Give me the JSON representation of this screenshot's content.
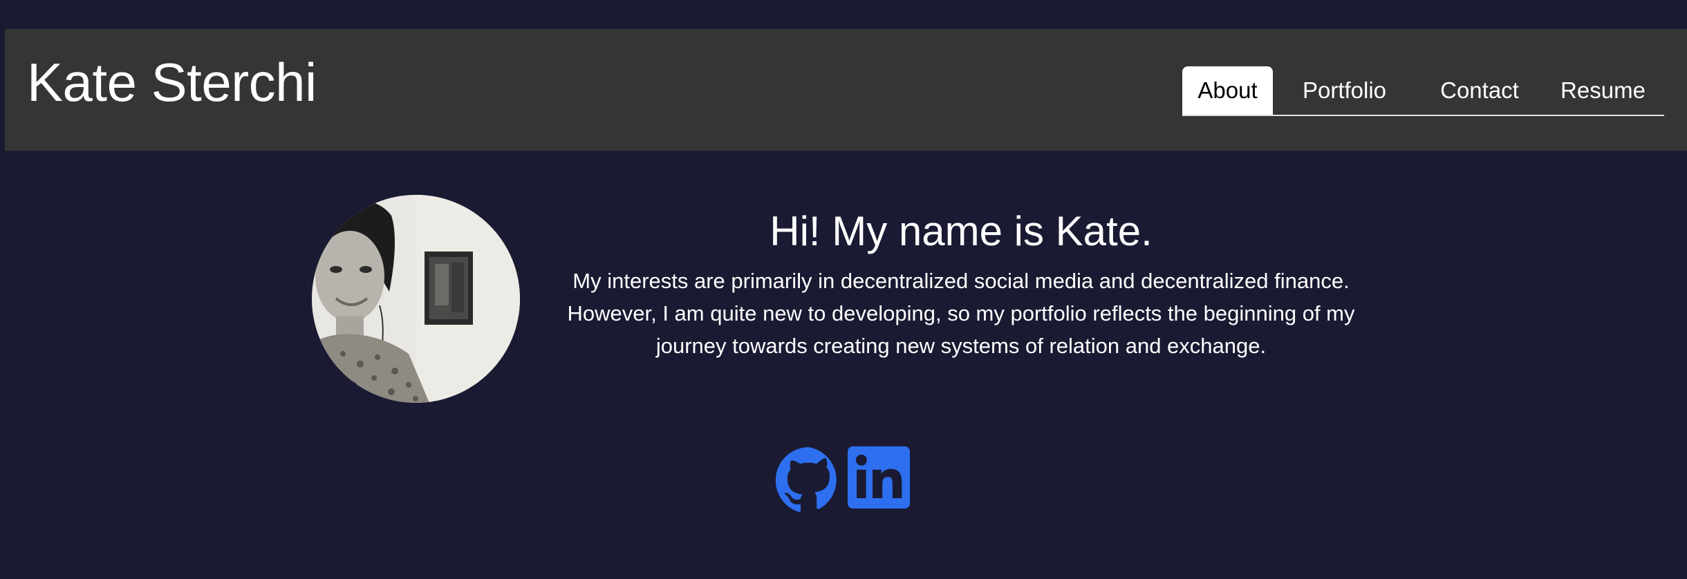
{
  "header": {
    "title": "Kate Sterchi"
  },
  "nav": {
    "items": [
      {
        "label": "About",
        "active": true
      },
      {
        "label": "Portfolio",
        "active": false
      },
      {
        "label": "Contact",
        "active": false
      },
      {
        "label": "Resume",
        "active": false
      }
    ]
  },
  "about": {
    "heading": "Hi! My name is Kate.",
    "text": "My interests are primarily in decentralized social media and decentralized finance. However, I am quite new to developing, so my portfolio reflects the beginning of my journey towards creating new systems of relation and exchange."
  },
  "social": {
    "icons": [
      "github-icon",
      "linkedin-icon"
    ],
    "accent_color": "#2e6ff0"
  },
  "colors": {
    "page_background": "#1a1b32",
    "header_background": "#353535"
  }
}
